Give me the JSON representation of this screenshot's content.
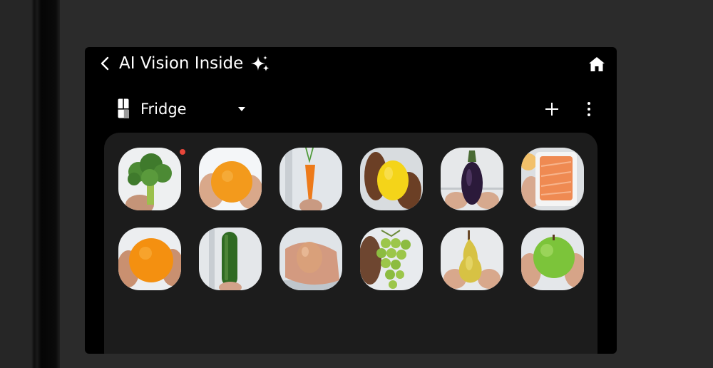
{
  "header": {
    "title": "AI Vision Inside"
  },
  "icons": {
    "back": "chevron-left-icon",
    "sparkle": "sparkle-icon",
    "home": "home-icon",
    "fridge": "fridge-icon",
    "dropdown": "caret-down-icon",
    "add": "plus-icon",
    "more": "more-vertical-icon"
  },
  "location": {
    "selected": "Fridge"
  },
  "colors": {
    "background": "#000000",
    "panel": "#1c1c1c",
    "notification_dot": "#e8463a",
    "text": "#ffffff"
  },
  "items": [
    {
      "name": "broccoli",
      "new": true
    },
    {
      "name": "orange",
      "new": false
    },
    {
      "name": "carrot",
      "new": false
    },
    {
      "name": "lemon",
      "new": false
    },
    {
      "name": "eggplant",
      "new": false
    },
    {
      "name": "salmon",
      "new": false
    },
    {
      "name": "orange",
      "new": false
    },
    {
      "name": "cucumber",
      "new": false
    },
    {
      "name": "egg",
      "new": false
    },
    {
      "name": "grapes",
      "new": false
    },
    {
      "name": "pear",
      "new": false
    },
    {
      "name": "apple",
      "new": false
    }
  ]
}
